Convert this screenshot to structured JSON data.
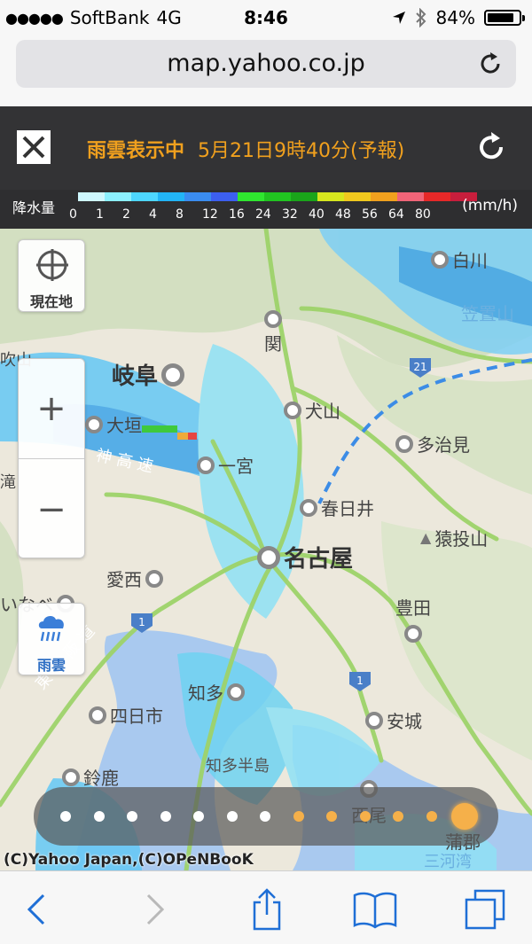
{
  "status_bar": {
    "carrier": "SoftBank",
    "network": "4G",
    "time": "8:46",
    "battery_percent": "84%",
    "battery_level": 0.84,
    "icons": [
      "signal-dots-icon",
      "location-arrow-icon",
      "bluetooth-icon",
      "battery-icon"
    ]
  },
  "browser": {
    "url": "map.yahoo.co.jp"
  },
  "header": {
    "status_label": "雨雲表示中",
    "timestamp": "5月21日9時40分(予報)",
    "accent_color": "#f0a01e"
  },
  "legend": {
    "label": "降水量",
    "unit": "(mm/h)",
    "ticks": [
      "0",
      "1",
      "2",
      "4",
      "8",
      "12",
      "16",
      "24",
      "32",
      "40",
      "48",
      "56",
      "64",
      "80"
    ],
    "colors": [
      "#cff8ff",
      "#8cf0ff",
      "#4dd6ff",
      "#22b4f5",
      "#3a8cf0",
      "#3c5ff0",
      "#2fe62f",
      "#21c421",
      "#1aa41a",
      "#d6e61e",
      "#f0c81e",
      "#f0a01e",
      "#f06478",
      "#e62828",
      "#c81e3c"
    ]
  },
  "map": {
    "current_location_label": "現在地",
    "rain_cloud_label": "雨雲",
    "zoom_in": "+",
    "zoom_out": "−",
    "copyright": "(C)Yahoo Japan,(C)OPeNBooK",
    "places": [
      {
        "name": "岐阜",
        "big": true
      },
      {
        "name": "大垣"
      },
      {
        "name": "一宮"
      },
      {
        "name": "犬山"
      },
      {
        "name": "多治見"
      },
      {
        "name": "春日井"
      },
      {
        "name": "名古屋",
        "big": true
      },
      {
        "name": "猿投山"
      },
      {
        "name": "愛西"
      },
      {
        "name": "豊田"
      },
      {
        "name": "知多"
      },
      {
        "name": "安城"
      },
      {
        "name": "四日市"
      },
      {
        "name": "鈴鹿"
      },
      {
        "name": "知多半島"
      },
      {
        "name": "西尾"
      },
      {
        "name": "蒲郡"
      },
      {
        "name": "関"
      },
      {
        "name": "白川"
      },
      {
        "name": "笠置山"
      },
      {
        "name": "いなべ"
      },
      {
        "name": "滝"
      },
      {
        "name": "吹山"
      },
      {
        "name": "神 高 速"
      },
      {
        "name": "東 名 阪 道"
      },
      {
        "name": "三河湾"
      }
    ],
    "route_shields": [
      "21",
      "1",
      "1"
    ]
  },
  "timeline": {
    "total_steps": 13,
    "past_steps": 7,
    "active_step": 13,
    "past_color": "#ffffff",
    "future_color": "#f5b04a"
  },
  "toolbar": {
    "icons": [
      "back-arrow-icon",
      "forward-arrow-icon",
      "share-icon",
      "bookmarks-icon",
      "tabs-icon"
    ]
  }
}
